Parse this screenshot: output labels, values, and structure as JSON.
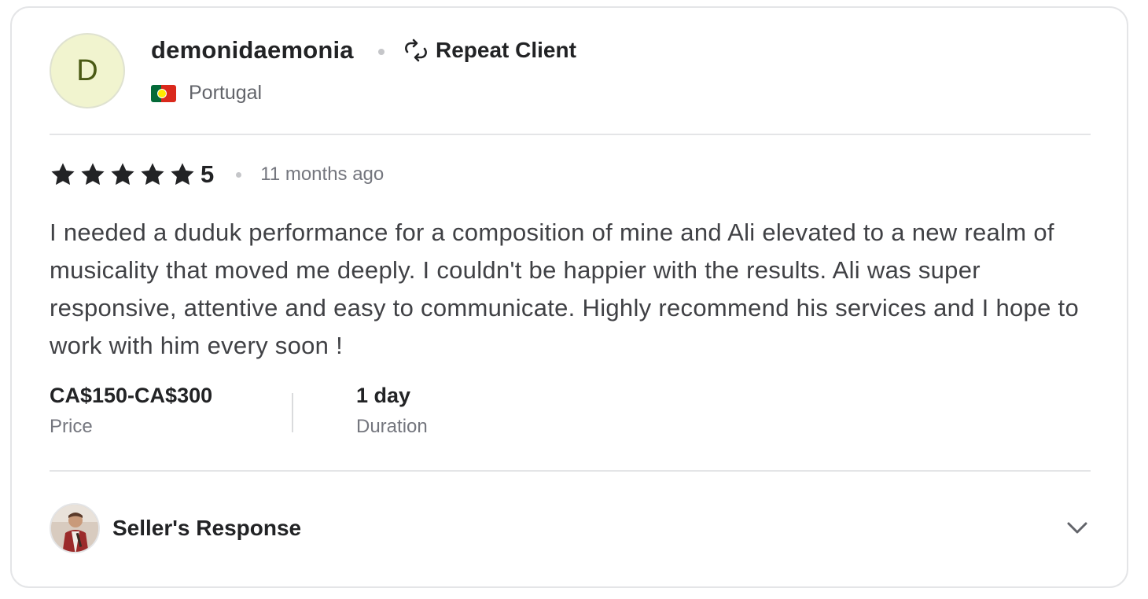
{
  "reviewer": {
    "initial": "D",
    "username": "demonidaemonia",
    "badge": "Repeat Client",
    "country": "Portugal",
    "avatar_bg": "#f1f4cf"
  },
  "rating": {
    "score": "5",
    "stars": 5,
    "time_ago": "11 months ago"
  },
  "review_text": "I needed a duduk performance for a composition of mine and Ali elevated to a new realm of musicality that moved me deeply. I couldn't be happier with the results. Ali was super responsive, attentive and easy to communicate. Highly recommend his services and I hope to work with him every soon !",
  "meta": {
    "price_value": "CA$150-CA$300",
    "price_label": "Price",
    "duration_value": "1 day",
    "duration_label": "Duration"
  },
  "seller_response": {
    "label": "Seller's Response",
    "icon": "chevron-down-icon"
  },
  "colors": {
    "text_primary": "#222325",
    "text_secondary": "#74767e",
    "border": "#e4e5e7"
  }
}
